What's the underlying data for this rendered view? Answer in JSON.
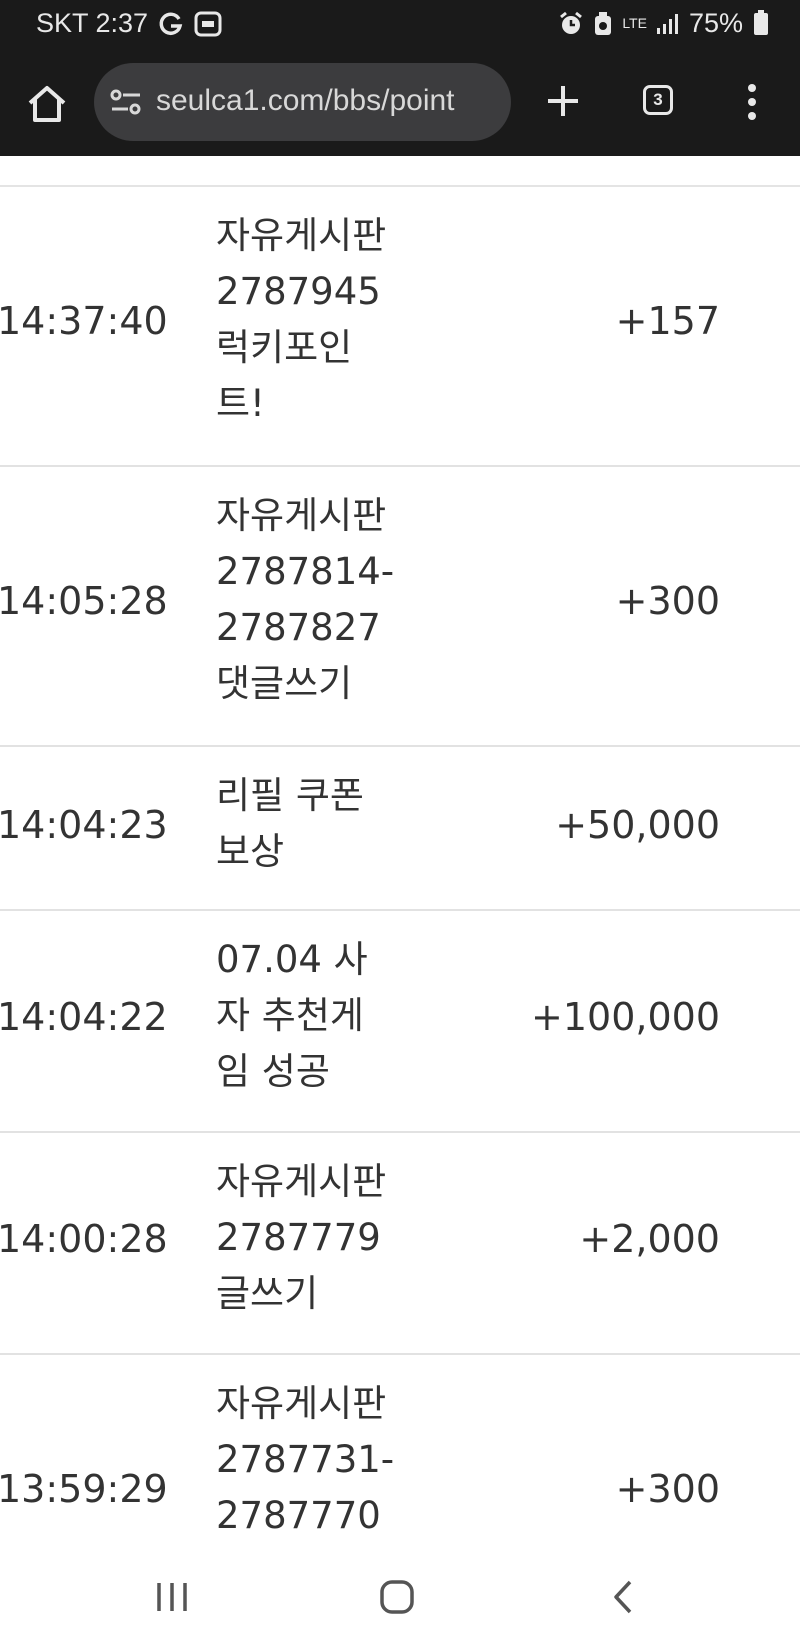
{
  "status_bar": {
    "carrier_time": "SKT 2:37",
    "network_label": "LTE",
    "battery_text": "75%"
  },
  "browser": {
    "url": "seulca1.com/bbs/point",
    "tab_count": "3"
  },
  "rows": [
    {
      "time": "14:37:40",
      "desc_lines": [
        "자유게시판",
        "2787945",
        "럭키포인",
        "트!"
      ],
      "point": "+157"
    },
    {
      "time": "14:05:28",
      "desc_lines": [
        "자유게시판",
        "2787814-",
        "2787827",
        "댓글쓰기"
      ],
      "point": "+300"
    },
    {
      "time": "14:04:23",
      "desc_lines": [
        "리필 쿠폰",
        "보상"
      ],
      "point": "+50,000"
    },
    {
      "time": "14:04:22",
      "desc_lines": [
        "07.04 사",
        "자 추천게",
        "임 성공"
      ],
      "point": "+100,000"
    },
    {
      "time": "14:00:28",
      "desc_lines": [
        "자유게시판",
        "2787779",
        "글쓰기"
      ],
      "point": "+2,000"
    },
    {
      "time": "13:59:29",
      "desc_lines": [
        "자유게시판",
        "2787731-",
        "2787770"
      ],
      "point": "+300"
    }
  ],
  "icons": {
    "home": "home-icon",
    "site_settings": "tune-icon",
    "new_tab": "plus-icon",
    "tabs": "tab-switcher-icon",
    "menu": "more-vert-icon",
    "nav_recent": "recent-apps-icon",
    "nav_home": "nav-home-icon",
    "nav_back": "back-icon"
  },
  "colors": {
    "chrome_bg": "#1a1a1a",
    "url_box_bg": "#3c3c3e",
    "text": "#333333",
    "divider": "#e2e2e2"
  }
}
